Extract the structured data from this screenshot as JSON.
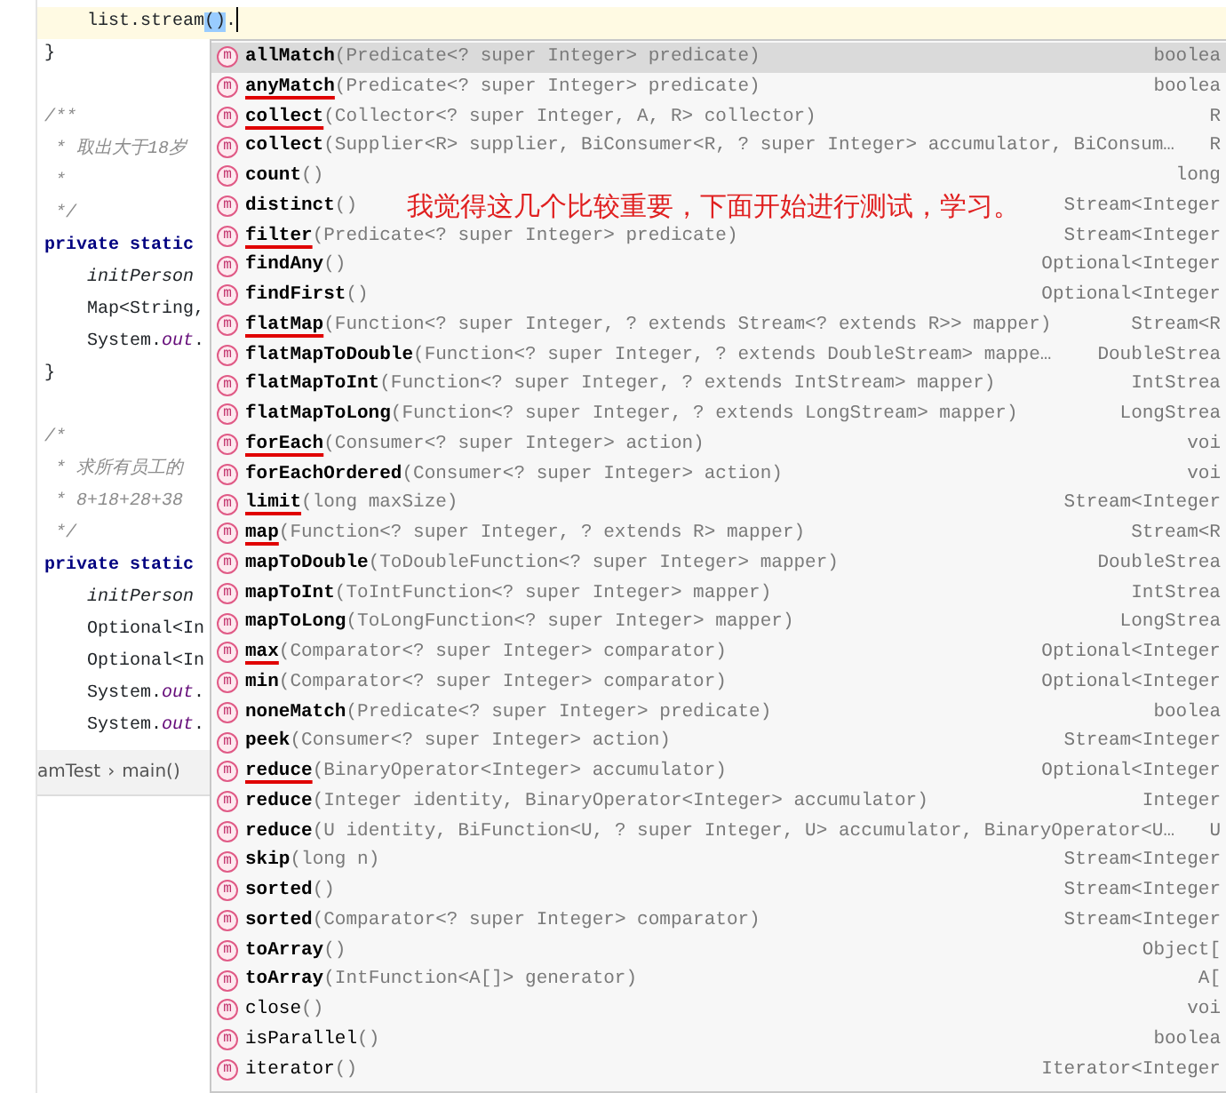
{
  "editor": {
    "lines": [
      {
        "kind": "inner",
        "current": true,
        "tokens": [
          {
            "text": "list.stream",
            "kind": "plain"
          },
          {
            "text": "()",
            "kind": "match"
          },
          {
            "text": ".",
            "kind": "plain"
          }
        ]
      },
      {
        "kind": "top",
        "current": false,
        "tokens": [
          {
            "text": "}",
            "kind": "plain"
          }
        ]
      },
      {
        "kind": "blank"
      },
      {
        "kind": "top",
        "current": false,
        "tokens": [
          {
            "text": "/**",
            "kind": "comment"
          }
        ]
      },
      {
        "kind": "top",
        "current": false,
        "tokens": [
          {
            "text": " * 取出大于18岁",
            "kind": "comment"
          }
        ]
      },
      {
        "kind": "top",
        "current": false,
        "tokens": [
          {
            "text": " *",
            "kind": "comment"
          }
        ]
      },
      {
        "kind": "top",
        "current": false,
        "tokens": [
          {
            "text": " */",
            "kind": "comment"
          }
        ]
      },
      {
        "kind": "top",
        "current": false,
        "tokens": [
          {
            "text": "private static",
            "kind": "keyword"
          }
        ]
      },
      {
        "kind": "inner",
        "current": false,
        "tokens": [
          {
            "text": "initPerson",
            "kind": "italic"
          }
        ]
      },
      {
        "kind": "inner",
        "current": false,
        "tokens": [
          {
            "text": "Map<String,",
            "kind": "plain"
          }
        ]
      },
      {
        "kind": "inner",
        "current": false,
        "tokens": [
          {
            "text": "System.",
            "kind": "plain"
          },
          {
            "text": "out",
            "kind": "field"
          },
          {
            "text": ".",
            "kind": "plain"
          }
        ]
      },
      {
        "kind": "top",
        "current": false,
        "tokens": [
          {
            "text": "}",
            "kind": "plain"
          }
        ]
      },
      {
        "kind": "blank"
      },
      {
        "kind": "top",
        "current": false,
        "tokens": [
          {
            "text": "/*",
            "kind": "comment"
          }
        ]
      },
      {
        "kind": "top",
        "current": false,
        "tokens": [
          {
            "text": " * 求所有员工的",
            "kind": "comment"
          }
        ]
      },
      {
        "kind": "top",
        "current": false,
        "tokens": [
          {
            "text": " * 8+18+28+38",
            "kind": "comment"
          }
        ]
      },
      {
        "kind": "top",
        "current": false,
        "tokens": [
          {
            "text": " */",
            "kind": "comment"
          }
        ]
      },
      {
        "kind": "top",
        "current": false,
        "tokens": [
          {
            "text": "private static",
            "kind": "keyword"
          }
        ]
      },
      {
        "kind": "inner",
        "current": false,
        "tokens": [
          {
            "text": "initPerson",
            "kind": "italic"
          }
        ]
      },
      {
        "kind": "inner",
        "current": false,
        "tokens": [
          {
            "text": "Optional<In",
            "kind": "plain"
          }
        ]
      },
      {
        "kind": "inner",
        "current": false,
        "tokens": [
          {
            "text": "Optional<In",
            "kind": "plain"
          }
        ]
      },
      {
        "kind": "inner",
        "current": false,
        "tokens": [
          {
            "text": "System.",
            "kind": "plain"
          },
          {
            "text": "out",
            "kind": "field"
          },
          {
            "text": ".",
            "kind": "plain"
          }
        ]
      },
      {
        "kind": "inner",
        "current": false,
        "tokens": [
          {
            "text": "System.",
            "kind": "plain"
          },
          {
            "text": "out",
            "kind": "field"
          },
          {
            "text": ".",
            "kind": "plain"
          }
        ]
      }
    ]
  },
  "breadcrumb": [
    "amTest",
    "›",
    "main()"
  ],
  "completion": {
    "items": [
      {
        "icon": "m",
        "name": "allMatch",
        "params": "(Predicate<? super Integer> predicate)",
        "type": "boolea",
        "bold": true,
        "selected": true,
        "underlined": false
      },
      {
        "icon": "m",
        "name": "anyMatch",
        "params": "(Predicate<? super Integer> predicate)",
        "type": "boolea",
        "bold": true,
        "selected": false,
        "underlined": true
      },
      {
        "icon": "m",
        "name": "collect",
        "params": "(Collector<? super Integer, A, R> collector)",
        "type": "R",
        "bold": true,
        "selected": false,
        "underlined": true
      },
      {
        "icon": "m",
        "name": "collect",
        "params": "(Supplier<R> supplier, BiConsumer<R, ? super Integer> accumulator, BiConsum…",
        "type": "R",
        "bold": true,
        "selected": false,
        "underlined": false
      },
      {
        "icon": "m",
        "name": "count",
        "params": "()",
        "type": "long",
        "bold": true,
        "selected": false,
        "underlined": false
      },
      {
        "icon": "m",
        "name": "distinct",
        "params": "()",
        "note": "我觉得这几个比较重要，下面开始进行测试，学习。",
        "type": "Stream<Integer",
        "bold": true,
        "selected": false,
        "underlined": false
      },
      {
        "icon": "m",
        "name": "filter",
        "params": "(Predicate<? super Integer> predicate)",
        "type": "Stream<Integer",
        "bold": true,
        "selected": false,
        "underlined": true
      },
      {
        "icon": "m",
        "name": "findAny",
        "params": "()",
        "type": "Optional<Integer",
        "bold": true,
        "selected": false,
        "underlined": false
      },
      {
        "icon": "m",
        "name": "findFirst",
        "params": "()",
        "type": "Optional<Integer",
        "bold": true,
        "selected": false,
        "underlined": false
      },
      {
        "icon": "m",
        "name": "flatMap",
        "params": "(Function<? super Integer, ? extends Stream<? extends R>> mapper)",
        "type": "Stream<R",
        "bold": true,
        "selected": false,
        "underlined": true
      },
      {
        "icon": "m",
        "name": "flatMapToDouble",
        "params": "(Function<? super Integer, ? extends DoubleStream> mappe…",
        "type": "DoubleStrea",
        "bold": true,
        "selected": false,
        "underlined": false
      },
      {
        "icon": "m",
        "name": "flatMapToInt",
        "params": "(Function<? super Integer, ? extends IntStream> mapper)",
        "type": "IntStrea",
        "bold": true,
        "selected": false,
        "underlined": false
      },
      {
        "icon": "m",
        "name": "flatMapToLong",
        "params": "(Function<? super Integer, ? extends LongStream> mapper)",
        "type": "LongStrea",
        "bold": true,
        "selected": false,
        "underlined": false
      },
      {
        "icon": "m",
        "name": "forEach",
        "params": "(Consumer<? super Integer> action)",
        "type": "voi",
        "bold": true,
        "selected": false,
        "underlined": true
      },
      {
        "icon": "m",
        "name": "forEachOrdered",
        "params": "(Consumer<? super Integer> action)",
        "type": "voi",
        "bold": true,
        "selected": false,
        "underlined": false
      },
      {
        "icon": "m",
        "name": "limit",
        "params": "(long maxSize)",
        "type": "Stream<Integer",
        "bold": true,
        "selected": false,
        "underlined": true
      },
      {
        "icon": "m",
        "name": "map",
        "params": "(Function<? super Integer, ? extends R> mapper)",
        "type": "Stream<R",
        "bold": true,
        "selected": false,
        "underlined": true
      },
      {
        "icon": "m",
        "name": "mapToDouble",
        "params": "(ToDoubleFunction<? super Integer> mapper)",
        "type": "DoubleStrea",
        "bold": true,
        "selected": false,
        "underlined": false
      },
      {
        "icon": "m",
        "name": "mapToInt",
        "params": "(ToIntFunction<? super Integer> mapper)",
        "type": "IntStrea",
        "bold": true,
        "selected": false,
        "underlined": false
      },
      {
        "icon": "m",
        "name": "mapToLong",
        "params": "(ToLongFunction<? super Integer> mapper)",
        "type": "LongStrea",
        "bold": true,
        "selected": false,
        "underlined": false
      },
      {
        "icon": "m",
        "name": "max",
        "params": "(Comparator<? super Integer> comparator)",
        "type": "Optional<Integer",
        "bold": true,
        "selected": false,
        "underlined": true
      },
      {
        "icon": "m",
        "name": "min",
        "params": "(Comparator<? super Integer> comparator)",
        "type": "Optional<Integer",
        "bold": true,
        "selected": false,
        "underlined": false
      },
      {
        "icon": "m",
        "name": "noneMatch",
        "params": "(Predicate<? super Integer> predicate)",
        "type": "boolea",
        "bold": true,
        "selected": false,
        "underlined": false
      },
      {
        "icon": "m",
        "name": "peek",
        "params": "(Consumer<? super Integer> action)",
        "type": "Stream<Integer",
        "bold": true,
        "selected": false,
        "underlined": false
      },
      {
        "icon": "m",
        "name": "reduce",
        "params": "(BinaryOperator<Integer> accumulator)",
        "type": "Optional<Integer",
        "bold": true,
        "selected": false,
        "underlined": true
      },
      {
        "icon": "m",
        "name": "reduce",
        "params": "(Integer identity, BinaryOperator<Integer> accumulator)",
        "type": "Integer",
        "bold": true,
        "selected": false,
        "underlined": false
      },
      {
        "icon": "m",
        "name": "reduce",
        "params": "(U identity, BiFunction<U, ? super Integer, U> accumulator, BinaryOperator<U…",
        "type": "U",
        "bold": true,
        "selected": false,
        "underlined": false
      },
      {
        "icon": "m",
        "name": "skip",
        "params": "(long n)",
        "type": "Stream<Integer",
        "bold": true,
        "selected": false,
        "underlined": false
      },
      {
        "icon": "m",
        "name": "sorted",
        "params": "()",
        "type": "Stream<Integer",
        "bold": true,
        "selected": false,
        "underlined": false
      },
      {
        "icon": "m",
        "name": "sorted",
        "params": "(Comparator<? super Integer> comparator)",
        "type": "Stream<Integer",
        "bold": true,
        "selected": false,
        "underlined": false
      },
      {
        "icon": "m",
        "name": "toArray",
        "params": "()",
        "type": "Object[",
        "bold": true,
        "selected": false,
        "underlined": false
      },
      {
        "icon": "m",
        "name": "toArray",
        "params": "(IntFunction<A[]> generator)",
        "type": "A[",
        "bold": true,
        "selected": false,
        "underlined": false
      },
      {
        "icon": "m",
        "name": "close",
        "params": "()",
        "type": "voi",
        "bold": false,
        "selected": false,
        "underlined": false
      },
      {
        "icon": "m",
        "name": "isParallel",
        "params": "()",
        "type": "boolea",
        "bold": false,
        "selected": false,
        "underlined": false
      },
      {
        "icon": "m",
        "name": "iterator",
        "params": "()",
        "type": "Iterator<Integer",
        "bold": false,
        "selected": false,
        "underlined": false
      }
    ]
  }
}
